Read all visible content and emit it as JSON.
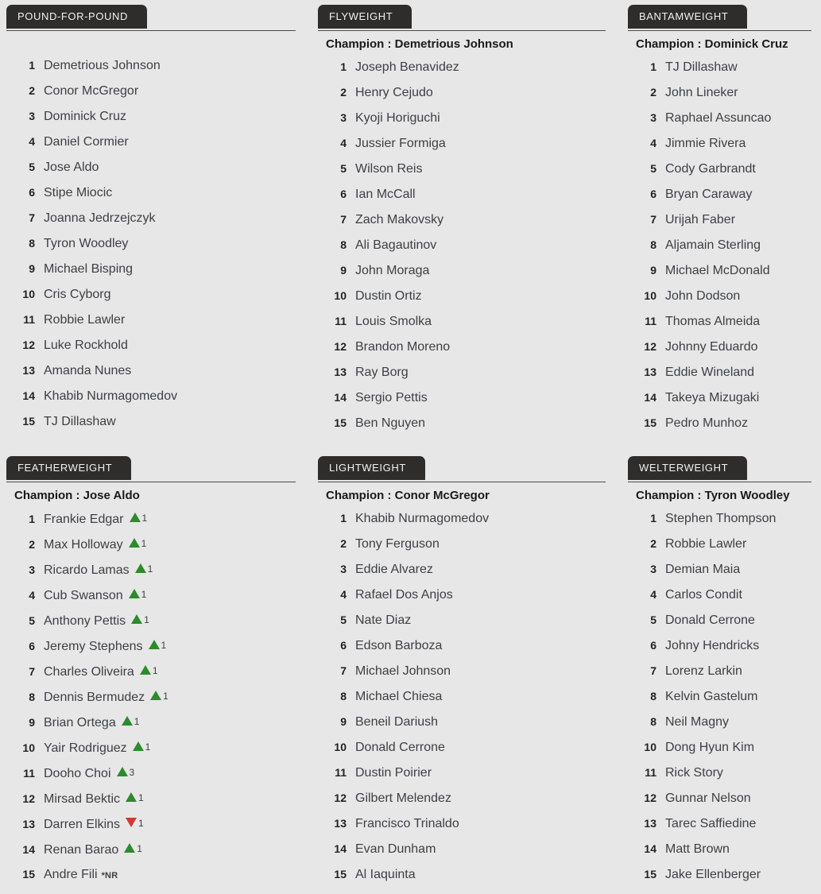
{
  "meta": {
    "champion_prefix": "Champion :",
    "colors": {
      "background": "#e7e7e7",
      "tab_background": "#2e2d2b",
      "tab_text": "#f2f1ee",
      "fighter_text": "#3d4044",
      "rank_text": "#222222",
      "up_arrow": "#2c8b2c",
      "down_arrow": "#d03a34"
    },
    "icons": {
      "up": "up-triangle-icon",
      "down": "down-triangle-icon"
    },
    "not_ranked_label": "*NR"
  },
  "divisions": [
    {
      "id": "pound-for-pound",
      "title": "POUND-FOR-POUND",
      "champion": null,
      "fighters": [
        {
          "rank": "1",
          "name": "Demetrious Johnson"
        },
        {
          "rank": "2",
          "name": "Conor McGregor"
        },
        {
          "rank": "3",
          "name": "Dominick Cruz"
        },
        {
          "rank": "4",
          "name": "Daniel Cormier"
        },
        {
          "rank": "5",
          "name": "Jose Aldo"
        },
        {
          "rank": "6",
          "name": "Stipe Miocic"
        },
        {
          "rank": "7",
          "name": "Joanna Jedrzejczyk"
        },
        {
          "rank": "8",
          "name": "Tyron Woodley"
        },
        {
          "rank": "9",
          "name": "Michael Bisping"
        },
        {
          "rank": "10",
          "name": "Cris Cyborg"
        },
        {
          "rank": "11",
          "name": "Robbie Lawler"
        },
        {
          "rank": "12",
          "name": "Luke Rockhold"
        },
        {
          "rank": "13",
          "name": "Amanda Nunes"
        },
        {
          "rank": "14",
          "name": "Khabib Nurmagomedov"
        },
        {
          "rank": "15",
          "name": "TJ Dillashaw"
        }
      ]
    },
    {
      "id": "flyweight",
      "title": "FLYWEIGHT",
      "champion": "Demetrious Johnson",
      "fighters": [
        {
          "rank": "1",
          "name": "Joseph Benavidez"
        },
        {
          "rank": "2",
          "name": "Henry Cejudo"
        },
        {
          "rank": "3",
          "name": "Kyoji Horiguchi"
        },
        {
          "rank": "4",
          "name": "Jussier Formiga"
        },
        {
          "rank": "5",
          "name": "Wilson Reis"
        },
        {
          "rank": "6",
          "name": "Ian McCall"
        },
        {
          "rank": "7",
          "name": "Zach Makovsky"
        },
        {
          "rank": "8",
          "name": "Ali Bagautinov"
        },
        {
          "rank": "9",
          "name": "John Moraga"
        },
        {
          "rank": "10",
          "name": "Dustin Ortiz"
        },
        {
          "rank": "11",
          "name": "Louis Smolka"
        },
        {
          "rank": "12",
          "name": "Brandon Moreno"
        },
        {
          "rank": "13",
          "name": "Ray Borg"
        },
        {
          "rank": "14",
          "name": "Sergio Pettis"
        },
        {
          "rank": "15",
          "name": "Ben Nguyen"
        }
      ]
    },
    {
      "id": "bantamweight",
      "title": "BANTAMWEIGHT",
      "champion": "Dominick Cruz",
      "fighters": [
        {
          "rank": "1",
          "name": "TJ Dillashaw"
        },
        {
          "rank": "2",
          "name": "John Lineker"
        },
        {
          "rank": "3",
          "name": "Raphael Assuncao"
        },
        {
          "rank": "4",
          "name": "Jimmie Rivera"
        },
        {
          "rank": "5",
          "name": "Cody Garbrandt"
        },
        {
          "rank": "6",
          "name": "Bryan Caraway"
        },
        {
          "rank": "7",
          "name": "Urijah Faber"
        },
        {
          "rank": "8",
          "name": "Aljamain Sterling"
        },
        {
          "rank": "9",
          "name": "Michael McDonald"
        },
        {
          "rank": "10",
          "name": "John Dodson"
        },
        {
          "rank": "11",
          "name": "Thomas Almeida"
        },
        {
          "rank": "12",
          "name": "Johnny Eduardo"
        },
        {
          "rank": "13",
          "name": "Eddie Wineland"
        },
        {
          "rank": "14",
          "name": "Takeya Mizugaki"
        },
        {
          "rank": "15",
          "name": "Pedro Munhoz"
        }
      ]
    },
    {
      "id": "featherweight",
      "title": "FEATHERWEIGHT",
      "champion": "Jose Aldo",
      "fighters": [
        {
          "rank": "1",
          "name": "Frankie Edgar",
          "move": "up",
          "move_amount": "1"
        },
        {
          "rank": "2",
          "name": "Max Holloway",
          "move": "up",
          "move_amount": "1"
        },
        {
          "rank": "3",
          "name": "Ricardo Lamas",
          "move": "up",
          "move_amount": "1"
        },
        {
          "rank": "4",
          "name": "Cub Swanson",
          "move": "up",
          "move_amount": "1"
        },
        {
          "rank": "5",
          "name": "Anthony Pettis",
          "move": "up",
          "move_amount": "1"
        },
        {
          "rank": "6",
          "name": "Jeremy Stephens",
          "move": "up",
          "move_amount": "1"
        },
        {
          "rank": "7",
          "name": "Charles Oliveira",
          "move": "up",
          "move_amount": "1"
        },
        {
          "rank": "8",
          "name": "Dennis Bermudez",
          "move": "up",
          "move_amount": "1"
        },
        {
          "rank": "9",
          "name": "Brian Ortega",
          "move": "up",
          "move_amount": "1"
        },
        {
          "rank": "10",
          "name": "Yair Rodriguez",
          "move": "up",
          "move_amount": "1"
        },
        {
          "rank": "11",
          "name": "Dooho Choi",
          "move": "up",
          "move_amount": "3"
        },
        {
          "rank": "12",
          "name": "Mirsad Bektic",
          "move": "up",
          "move_amount": "1"
        },
        {
          "rank": "13",
          "name": "Darren Elkins",
          "move": "down",
          "move_amount": "1"
        },
        {
          "rank": "14",
          "name": "Renan Barao",
          "move": "up",
          "move_amount": "1"
        },
        {
          "rank": "15",
          "name": "Andre Fili",
          "move": "nr"
        }
      ]
    },
    {
      "id": "lightweight",
      "title": "LIGHTWEIGHT",
      "champion": "Conor McGregor",
      "fighters": [
        {
          "rank": "1",
          "name": "Khabib Nurmagomedov"
        },
        {
          "rank": "2",
          "name": "Tony Ferguson"
        },
        {
          "rank": "3",
          "name": "Eddie Alvarez"
        },
        {
          "rank": "4",
          "name": "Rafael Dos Anjos"
        },
        {
          "rank": "5",
          "name": "Nate Diaz"
        },
        {
          "rank": "6",
          "name": "Edson Barboza"
        },
        {
          "rank": "7",
          "name": "Michael Johnson"
        },
        {
          "rank": "8",
          "name": "Michael Chiesa"
        },
        {
          "rank": "9",
          "name": "Beneil Dariush"
        },
        {
          "rank": "10",
          "name": "Donald Cerrone"
        },
        {
          "rank": "11",
          "name": "Dustin Poirier"
        },
        {
          "rank": "12",
          "name": "Gilbert Melendez"
        },
        {
          "rank": "13",
          "name": "Francisco Trinaldo"
        },
        {
          "rank": "14",
          "name": "Evan Dunham"
        },
        {
          "rank": "15",
          "name": "Al Iaquinta"
        }
      ]
    },
    {
      "id": "welterweight",
      "title": "WELTERWEIGHT",
      "champion": "Tyron Woodley",
      "fighters": [
        {
          "rank": "1",
          "name": "Stephen Thompson"
        },
        {
          "rank": "2",
          "name": "Robbie Lawler"
        },
        {
          "rank": "3",
          "name": "Demian Maia"
        },
        {
          "rank": "4",
          "name": "Carlos Condit"
        },
        {
          "rank": "5",
          "name": "Donald Cerrone"
        },
        {
          "rank": "6",
          "name": "Johny Hendricks"
        },
        {
          "rank": "7",
          "name": "Lorenz Larkin"
        },
        {
          "rank": "8",
          "name": "Kelvin Gastelum"
        },
        {
          "rank": "8",
          "name": "Neil Magny"
        },
        {
          "rank": "10",
          "name": "Dong Hyun Kim"
        },
        {
          "rank": "11",
          "name": "Rick Story"
        },
        {
          "rank": "12",
          "name": "Gunnar Nelson"
        },
        {
          "rank": "13",
          "name": "Tarec Saffiedine"
        },
        {
          "rank": "14",
          "name": "Matt Brown"
        },
        {
          "rank": "15",
          "name": "Jake Ellenberger"
        }
      ]
    }
  ]
}
